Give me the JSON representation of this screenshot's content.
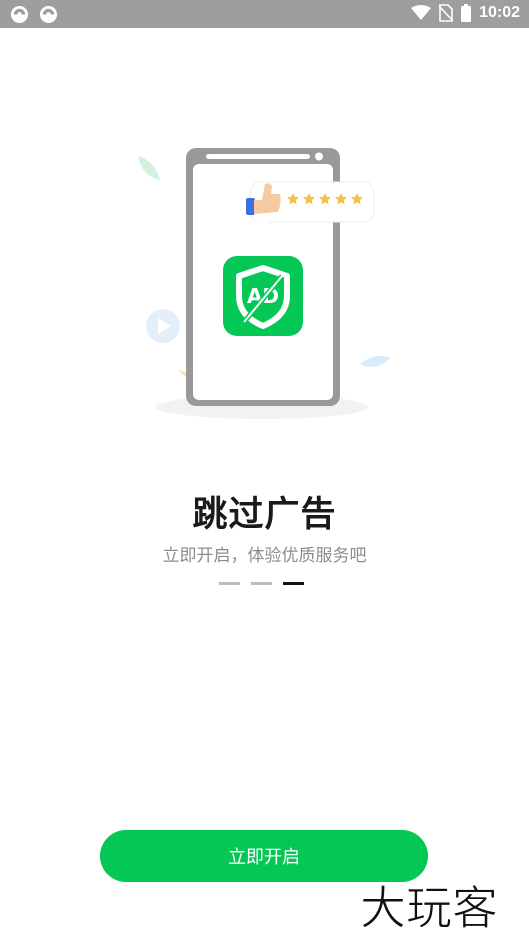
{
  "status_bar": {
    "time": "10:02",
    "left_icons": [
      "sync-icon",
      "sync-icon"
    ],
    "right_icons": [
      "wifi-icon",
      "no-sim-icon",
      "battery-icon"
    ]
  },
  "onboarding": {
    "title": "跳过广告",
    "subtitle": "立即开启，体验优质服务吧",
    "page_count": 3,
    "active_page": 3,
    "badge_text": "AD",
    "rating_stars": 5
  },
  "cta": {
    "label": "立即开启"
  },
  "watermark": {
    "text": "大玩客"
  },
  "colors": {
    "status_bar": "#9e9e9e",
    "accent": "#05c756",
    "star": "#f7c04a",
    "title": "#1a1a1a",
    "subtitle": "#8c8c8c"
  }
}
